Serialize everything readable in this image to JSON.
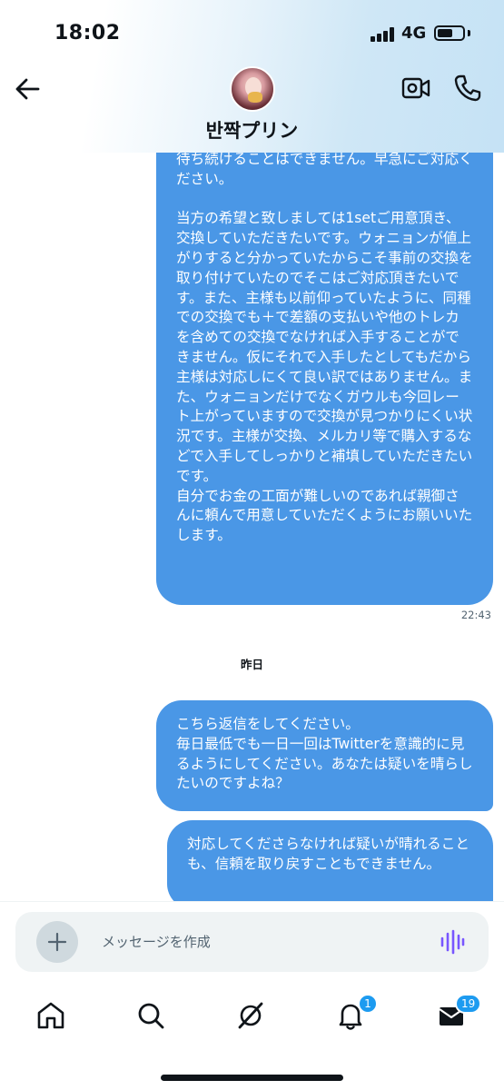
{
  "status_bar": {
    "time": "18:02",
    "network": "4G"
  },
  "header": {
    "contact_name": "반짝プリン"
  },
  "messages": [
    {
      "text": "待ち続けることはできません。早急にご対応ください。\n\n当方の希望と致しましては1setご用意頂き、交換していただきたいです。ウォニョンが値上がりすると分かっていたからこそ事前の交換を取り付けていたのでそこはご対応頂きたいです。また、主様も以前仰っていたように、同種での交換でも＋で差額の支払いや他のトレカを含めての交換でなければ入手することができません。仮にそれで入手したとしてもだから主様は対応しにくて良い訳ではありません。また、ウォニョンだけでなくガウルも今回レート上がっていますので交換が見つかりにくい状況です。主様が交換、メルカリ等で購入するなどで入手してしっかりと補填していただきたいです。\n自分でお金の工面が難しいのであれば親御さんに頼んで用意していただくようにお願いいたします。",
      "time": "22:43"
    },
    {
      "text": "こちら返信をしてください。\n毎日最低でも一日一回はTwitterを意識的に見るようにしてください。あなたは疑いを晴らしたいのですよね？"
    },
    {
      "text": "対応してくださらなければ疑いが晴れることも、信頼を取り戻すこともできません。"
    }
  ],
  "date_separator": "昨日",
  "composer": {
    "placeholder": "メッセージを作成"
  },
  "nav": {
    "notifications_badge": "1",
    "messages_badge": "19"
  },
  "colors": {
    "accent": "#1d9bf0",
    "bubble": "#4a97e6"
  }
}
